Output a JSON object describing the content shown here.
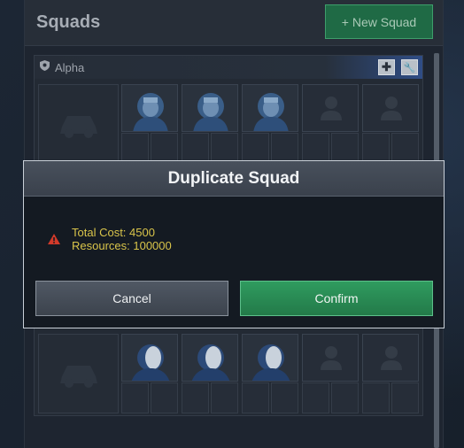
{
  "panel": {
    "title": "Squads",
    "new_squad_label": "+ New Squad"
  },
  "squads": [
    {
      "name": "Alpha",
      "slots_filled": 3,
      "slots_empty": 2
    },
    {
      "name": "",
      "slots_filled": 3,
      "slots_empty": 2
    }
  ],
  "modal": {
    "title": "Duplicate Squad",
    "total_cost": "Total Cost: 4500",
    "resources": "Resources: 100000",
    "cancel_label": "Cancel",
    "confirm_label": "Confirm"
  },
  "colors": {
    "confirm": "#2f9b5f",
    "warning": "#d9c44a",
    "warning_icon": "#d23a2a"
  },
  "icons": {
    "add": "plus-icon",
    "edit": "wrench-icon",
    "squad": "shield-icon",
    "vehicle": "vehicle-icon",
    "warning": "warning-icon"
  }
}
